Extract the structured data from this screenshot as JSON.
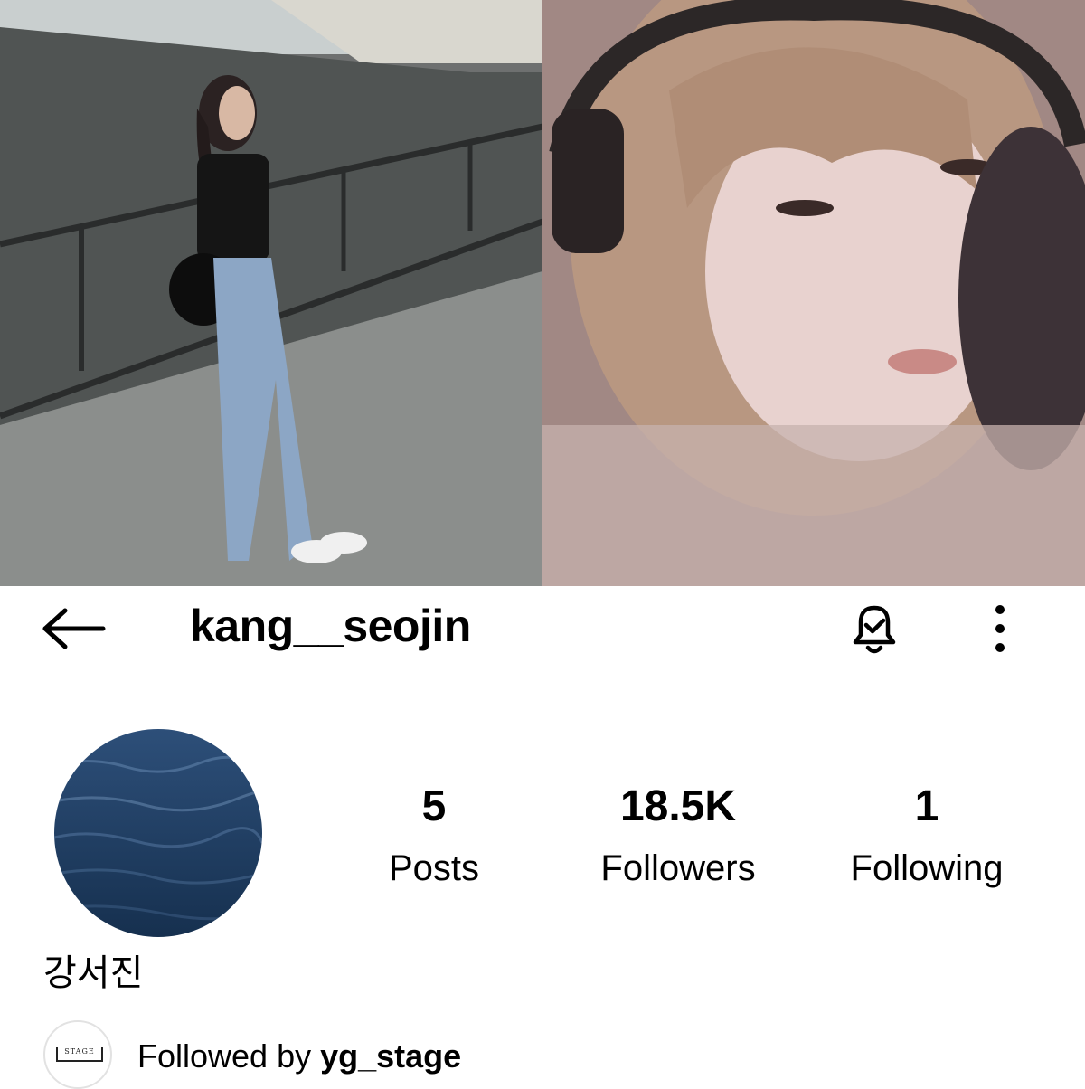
{
  "header": {
    "username": "kang__seojin",
    "back_icon": "arrow-left-icon",
    "bell_icon": "bell-check-icon",
    "more_icon": "more-vertical-icon"
  },
  "profile": {
    "display_name": "강서진",
    "stats": [
      {
        "value": "5",
        "label": "Posts"
      },
      {
        "value": "18.5K",
        "label": "Followers"
      },
      {
        "value": "1",
        "label": "Following"
      }
    ]
  },
  "followed_by": {
    "prefix": "Followed by ",
    "account": "yg_stage",
    "avatar_text": "STAGE"
  },
  "colors": {
    "text": "#000000",
    "background": "#ffffff",
    "ocean": "#1e3d66"
  }
}
